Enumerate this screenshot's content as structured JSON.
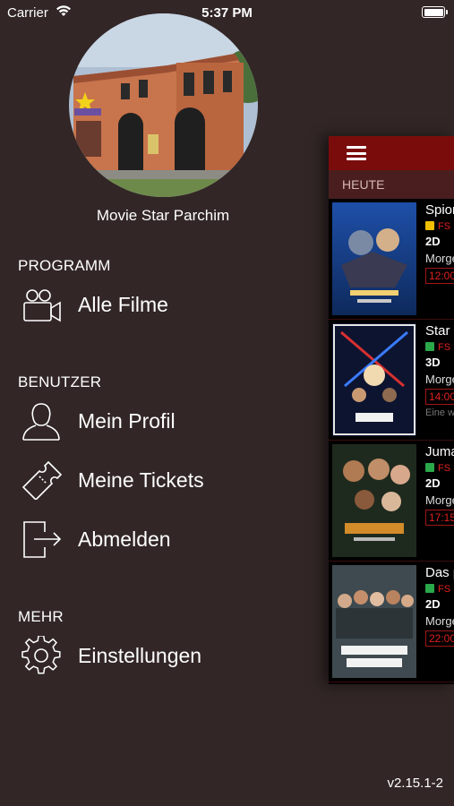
{
  "status": {
    "carrier": "Carrier",
    "time": "5:37 PM"
  },
  "cinema": {
    "name": "Movie Star Parchim"
  },
  "sections": {
    "program": "PROGRAMM",
    "user": "BENUTZER",
    "more": "MEHR"
  },
  "menu": {
    "all_films": "Alle Filme",
    "profile": "Mein Profil",
    "tickets": "Meine Tickets",
    "logout": "Abmelden",
    "settings": "Einstellungen"
  },
  "version": "v2.15.1-2",
  "main": {
    "day_tab": "HEUTE",
    "films": [
      {
        "title": "Spion",
        "fsk": "FS",
        "fsk_color": "#f0c000",
        "format": "2D",
        "daypart": "Morge",
        "time": "12:00",
        "extra": ""
      },
      {
        "title": "Star",
        "fsk": "FS",
        "fsk_color": "#2aa84a",
        "format": "3D",
        "daypart": "Morge",
        "time": "14:00",
        "extra": "Eine w"
      },
      {
        "title": "Juma",
        "fsk": "FS",
        "fsk_color": "#2aa84a",
        "format": "2D",
        "daypart": "Morge",
        "time": "17:15",
        "extra": ""
      },
      {
        "title": "Das p",
        "fsk": "FS",
        "fsk_color": "#2aa84a",
        "format": "2D",
        "daypart": "Morge",
        "time": "22:00",
        "extra": ""
      }
    ]
  },
  "colors": {
    "background": "#322626",
    "navbar": "#7a0c0c",
    "accent_red": "#e02020"
  },
  "icons": {
    "all_films": "video-camera-icon",
    "profile": "user-icon",
    "tickets": "ticket-icon",
    "logout": "logout-icon",
    "settings": "gear-icon",
    "menu": "hamburger-icon"
  }
}
